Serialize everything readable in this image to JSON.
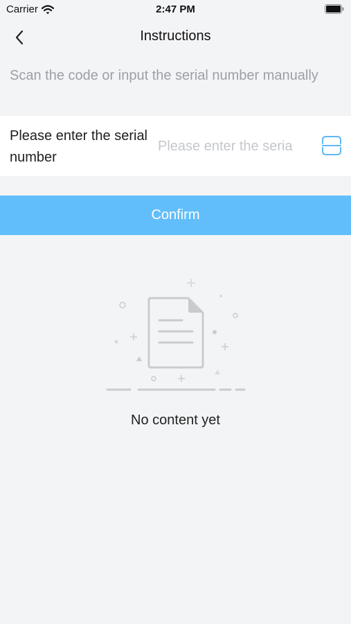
{
  "status_bar": {
    "carrier": "Carrier",
    "time": "2:47 PM",
    "wifi_icon": "wifi-icon",
    "battery_icon": "battery-icon"
  },
  "nav": {
    "title": "Instructions",
    "back_icon": "chevron-left-icon"
  },
  "hint": "Scan the code or input the serial number manually",
  "serial": {
    "label": "Please enter the serial number",
    "value": "",
    "placeholder": "Please enter the seria",
    "scan_icon": "scan-icon"
  },
  "confirm_label": "Confirm",
  "empty_state": {
    "icon": "empty-document-icon",
    "text": "No content yet"
  },
  "colors": {
    "accent": "#62befa",
    "scan_icon": "#5db8f5",
    "background": "#f3f4f6",
    "card": "#ffffff",
    "hint_text": "#9b9fa6",
    "placeholder_text": "#c4c7cc",
    "illustration": "#c9cbcf"
  }
}
